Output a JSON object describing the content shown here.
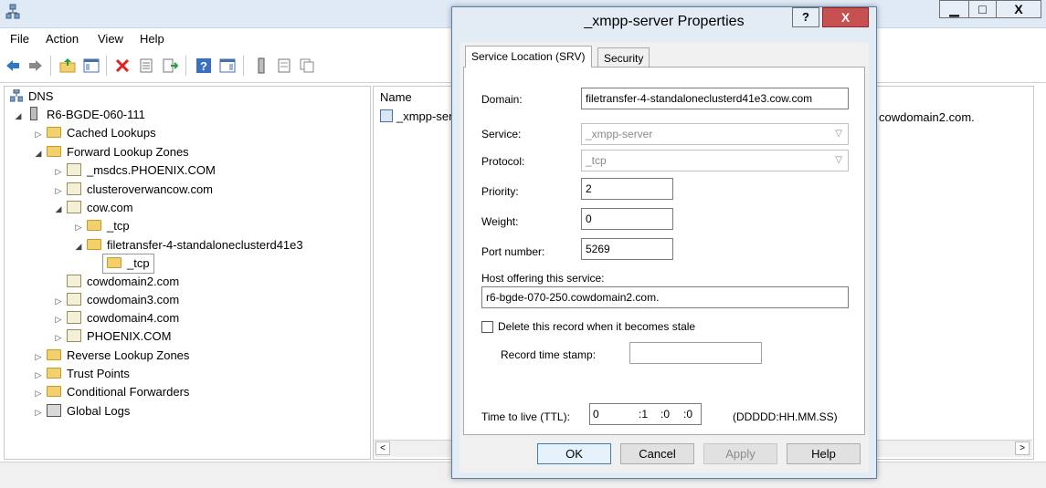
{
  "window": {
    "min_glyph": "▁",
    "max_glyph": "□",
    "close_glyph": "X"
  },
  "menu": [
    "File",
    "Action",
    "View",
    "Help"
  ],
  "tree": {
    "root": "DNS",
    "server": "R6-BGDE-060-111",
    "cached": "Cached Lookups",
    "forward": "Forward Lookup Zones",
    "zones": [
      "_msdcs.PHOENIX.COM",
      "clusteroverwancow.com",
      "cow.com"
    ],
    "cow_children": [
      "_tcp",
      "filetransfer-4-standaloneclusterd41e3"
    ],
    "selected": "_tcp",
    "zones_after": [
      "cowdomain2.com",
      "cowdomain3.com",
      "cowdomain4.com",
      "PHOENIX.COM"
    ],
    "reverse": "Reverse Lookup Zones",
    "trust": "Trust Points",
    "conditional": "Conditional Forwarders",
    "global_logs": "Global Logs"
  },
  "list": {
    "column_name": "Name",
    "row_name": "_xmpp-ser",
    "row_data": "cowdomain2.com."
  },
  "dialog": {
    "title": "_xmpp-server Properties",
    "help_glyph": "?",
    "close_glyph": "X",
    "tabs": [
      "Service Location (SRV)",
      "Security"
    ],
    "domain_label": "Domain:",
    "domain_value": "filetransfer-4-standaloneclusterd41e3.cow.com",
    "service_label": "Service:",
    "service_value": "_xmpp-server",
    "protocol_label": "Protocol:",
    "protocol_value": "_tcp",
    "priority_label": "Priority:",
    "priority_value": "2",
    "weight_label": "Weight:",
    "weight_value": "0",
    "port_label": "Port number:",
    "port_value": "5269",
    "host_label": "Host offering this service:",
    "host_value": "r6-bgde-070-250.cowdomain2.com.",
    "stale_label": "Delete this record when it becomes stale",
    "timestamp_label": "Record time stamp:",
    "ttl_label": "Time to live (TTL):",
    "ttl_days": "0",
    "ttl_hours": ":1",
    "ttl_minutes": ":0",
    "ttl_seconds": ":0",
    "ttl_format": "(DDDDD:HH.MM.SS)",
    "ok": "OK",
    "cancel": "Cancel",
    "apply": "Apply",
    "help": "Help"
  }
}
